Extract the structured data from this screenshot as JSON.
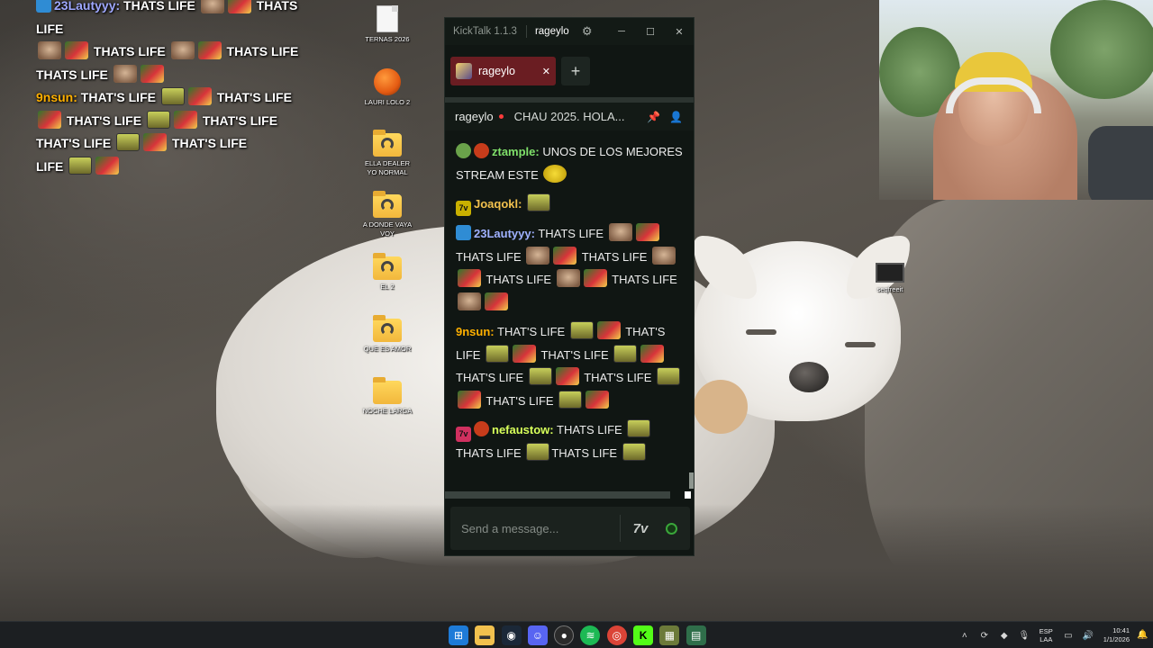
{
  "overlay_chat": {
    "lines": [
      {
        "user": "23Lautyyy:",
        "text": "THATS LIFE"
      },
      {
        "text": "THATS LIFE"
      },
      {
        "text": "THATS LIFE"
      },
      {
        "text": "THATS LIFE"
      },
      {
        "user": "9nsun:",
        "text": "THAT'S LIFE"
      },
      {
        "text": "THAT'S LIFE"
      },
      {
        "text": "THAT'S LIFE"
      },
      {
        "text": "THAT'S LIFE"
      },
      {
        "text": "THAT'S LIFE"
      },
      {
        "text": "THAT'S LIFE"
      },
      {
        "text": "THAT'S LIFE"
      },
      {
        "text": "THAT'S"
      },
      {
        "text": "LIFE"
      }
    ]
  },
  "desktop_icons": [
    {
      "label": "TERNAS 2026",
      "icon": "file-icon"
    },
    {
      "label": "LAURI LOLO 2",
      "icon": "fl-studio-icon"
    },
    {
      "label": "ELLA DEALER YO NORMAL",
      "icon": "folder-icon"
    },
    {
      "label": "A DONDE VAYA VOY",
      "icon": "folder-icon"
    },
    {
      "label": "EL 2",
      "icon": "folder-icon"
    },
    {
      "label": "QUE ES AMOR",
      "icon": "folder-icon"
    },
    {
      "label": "NOCHE LARGA",
      "icon": "folder-icon"
    },
    {
      "label": "seqfreeit",
      "icon": "video-file-icon"
    }
  ],
  "kicktalk": {
    "app_name": "KickTalk 1.1.3",
    "user": "rageylo",
    "tab_label": "rageylo",
    "channel_name": "rageylo",
    "stream_title": "CHAU 2025. HOLA...",
    "input_placeholder": "Send a message...",
    "seven_tv_label": "7v",
    "messages": [
      {
        "user": "ztample:",
        "user_color": "#7fe06a",
        "text": "UNOS DE LOS MEJORES STREAM ESTE"
      },
      {
        "user": "Joaqokl:",
        "user_color": "#f2c14e",
        "text": ""
      },
      {
        "user": "23Lautyyy:",
        "user_color": "#9fb1ff",
        "text": "THATS LIFE"
      },
      {
        "user": "9nsun:",
        "user_color": "#ffb000",
        "text": "THAT'S LIFE"
      },
      {
        "user": "nefaustow:",
        "user_color": "#d7ff5a",
        "text": "THATS LIFE"
      }
    ],
    "msg_texts": {
      "laut_a": "THATS LIFE",
      "laut_b": "THATS LIFE",
      "laut_c": "THATS LIFE",
      "laut_d": "THATS LIFE",
      "laut_e": "THATS LIFE",
      "nsun_a": "THAT'S",
      "nsun_b": "LIFE",
      "nsun_c": "THAT'S LIFE",
      "nsun_d": "THAT'S LIFE",
      "nsun_e": "THAT'S LIFE",
      "nsun_f": "THAT'S LIFE",
      "nsun_g": "THAT'S LIFE",
      "nefa_a": "THATS LIFE",
      "nefa_b": "THATS LIFE"
    }
  },
  "taskbar": {
    "apps": [
      "windows-start-icon",
      "file-explorer-icon",
      "steam-icon",
      "discord-icon",
      "obs-icon",
      "spotify-icon",
      "chrome-icon",
      "kick-icon",
      "game-icon",
      "kicktalk-icon"
    ],
    "lang_top": "ESP",
    "lang_bottom": "LAA",
    "time": "10:41",
    "date": "1/1/2026"
  }
}
